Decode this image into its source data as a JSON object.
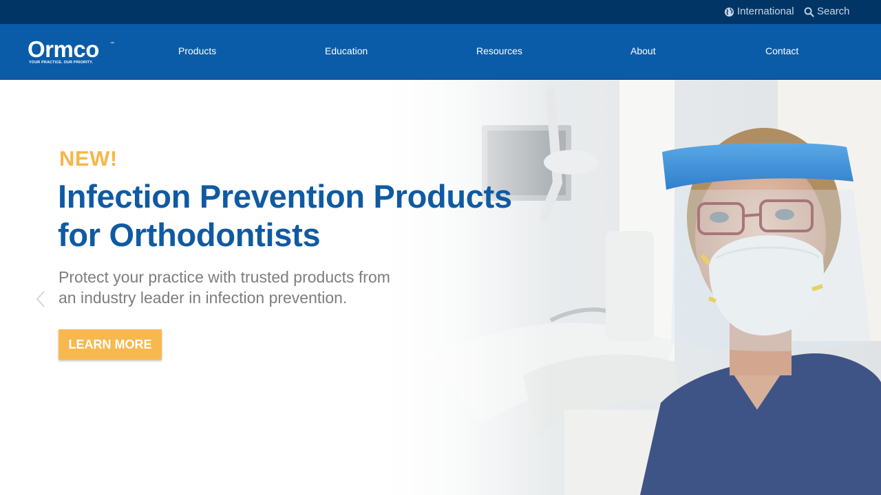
{
  "utility": {
    "international": "International",
    "search": "Search"
  },
  "brand": {
    "name": "Ormco",
    "tm": "™",
    "tagline": "YOUR PRACTICE. OUR PRIORITY."
  },
  "nav": {
    "items": [
      {
        "label": "Products"
      },
      {
        "label": "Education"
      },
      {
        "label": "Resources"
      },
      {
        "label": "About"
      },
      {
        "label": "Contact"
      }
    ]
  },
  "hero": {
    "eyebrow": "NEW!",
    "headline_line1": "Infection Prevention Products",
    "headline_line2": "for Orthodontists",
    "subtext_line1": "Protect your practice with trusted products from",
    "subtext_line2": "an industry leader in infection prevention.",
    "cta": "LEARN MORE"
  },
  "icons": {
    "globe": "globe-icon",
    "search": "search-icon",
    "prev": "chevron-left-icon",
    "next": "chevron-right-icon"
  },
  "colors": {
    "utility_bar": "#003566",
    "nav_bar": "#0a5ca8",
    "eyebrow": "#f7b64a",
    "headline": "#0f5aa3",
    "subtext": "#7d7d7d",
    "cta": "#f8b850"
  }
}
